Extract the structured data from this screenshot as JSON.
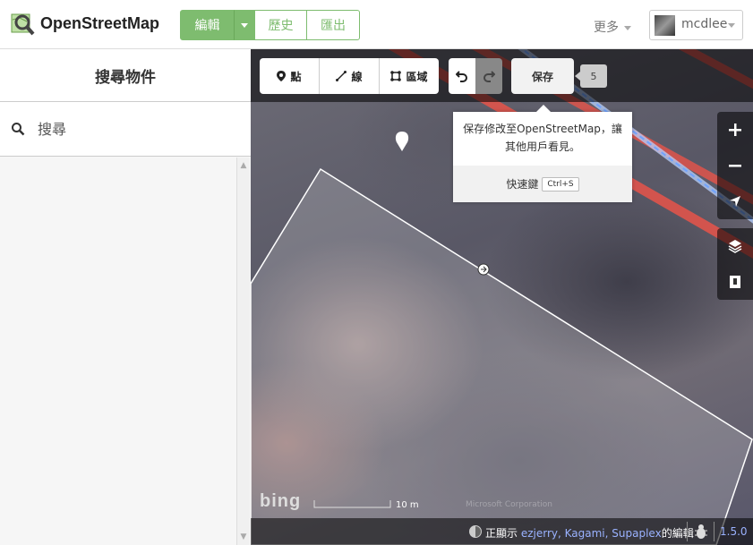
{
  "header": {
    "brand": "OpenStreetMap",
    "edit_label": "編輯",
    "history_label": "歷史",
    "export_label": "匯出",
    "more_label": "更多",
    "username": "mcdlee"
  },
  "sidebar": {
    "title": "搜尋物件",
    "search_placeholder": "搜尋"
  },
  "toolbar": {
    "point_label": "點",
    "line_label": "線",
    "area_label": "區域",
    "save_label": "保存",
    "changes_count": "5"
  },
  "save_tooltip": {
    "text": "保存修改至OpenStreetMap，讓其他用戶看見。",
    "shortcut_label": "快速鍵",
    "shortcut_key": "Ctrl+S"
  },
  "map": {
    "imagery_logo": "bing",
    "scale_label": "10 m",
    "attribution": "Microsoft Corporation",
    "credits_prefix": "正顯示",
    "credits_users": "ezjerry, Kagami, Supaplex",
    "credits_suffix": "的編輯",
    "version": "1.5.0"
  },
  "icons": {
    "logo": "magnifier-map-icon",
    "search": "search-icon",
    "point": "pin-icon",
    "line": "line-icon",
    "area": "area-icon",
    "undo": "undo-icon",
    "redo": "redo-icon",
    "zoom_in": "plus-icon",
    "zoom_out": "minus-icon",
    "geolocate": "locate-arrow-icon",
    "layers": "layers-icon",
    "map_data": "map-data-icon",
    "help": "help-book-icon",
    "bug": "bug-icon"
  },
  "colors": {
    "brand_green": "#7ebc6f",
    "road_red": "#e8544a",
    "path_blue": "#6fa3ff",
    "link_blue": "#9ab2ff"
  }
}
